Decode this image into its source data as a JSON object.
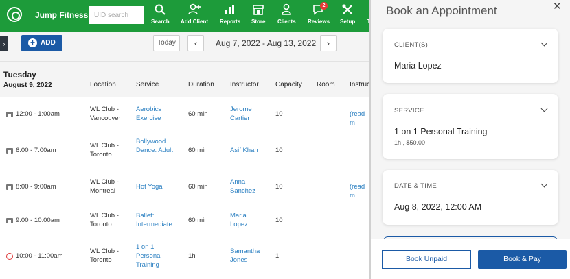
{
  "app": {
    "brand": "Jump Fitness",
    "uid_placeholder": "UID search"
  },
  "nav": [
    {
      "label": "Search",
      "icon": "search-icon"
    },
    {
      "label": "Add Client",
      "icon": "add-user-icon"
    },
    {
      "label": "Reports",
      "icon": "chart-icon"
    },
    {
      "label": "Store",
      "icon": "store-icon"
    },
    {
      "label": "Clients",
      "icon": "user-icon"
    },
    {
      "label": "Reviews",
      "icon": "chat-icon",
      "badge": "2"
    },
    {
      "label": "Setup",
      "icon": "tools-icon"
    },
    {
      "label": "T",
      "icon": "more-icon"
    }
  ],
  "toolbar": {
    "add_label": "ADD",
    "today_label": "Today",
    "prev_label": "‹",
    "next_label": "›",
    "date_range": "Aug 7, 2022 - Aug 13, 2022",
    "collapse_label": "›"
  },
  "schedule": {
    "day": "Tuesday",
    "date": "August 9, 2022",
    "columns": [
      "Location",
      "Service",
      "Duration",
      "Instructor",
      "Capacity",
      "Room",
      "Instruc"
    ],
    "rows": [
      {
        "time": "12:00 - 1:00am",
        "location": "WL Club - Vancouver",
        "service": "Aerobics Exercise",
        "duration": "60 min",
        "instructor": "Jerome Cartier",
        "capacity": "10",
        "note": "(read m"
      },
      {
        "time": "6:00 - 7:00am",
        "location": "WL Club - Toronto",
        "service": "Bollywood Dance: Adult",
        "duration": "60 min",
        "instructor": "Asif Khan",
        "capacity": "10",
        "note": ""
      },
      {
        "time": "8:00 - 9:00am",
        "location": "WL Club - Montreal",
        "service": "Hot Yoga",
        "duration": "60 min",
        "instructor": "Anna Sanchez",
        "capacity": "10",
        "note": "(read m"
      },
      {
        "time": "9:00 - 10:00am",
        "location": "WL Club - Toronto",
        "service": "Ballet: Intermediate",
        "duration": "60 min",
        "instructor": "Maria Lopez",
        "capacity": "10",
        "note": ""
      },
      {
        "time": "10:00 - 11:00am",
        "location": "WL Club - Toronto",
        "service": "1 on 1 Personal Training",
        "duration": "1h",
        "instructor": "Samantha Jones",
        "capacity": "1",
        "note": ""
      }
    ]
  },
  "panel": {
    "title": "Book an Appointment",
    "close": "✕",
    "client": {
      "label": "CLIENT(S)",
      "value": "Maria Lopez"
    },
    "service": {
      "label": "SERVICE",
      "value": "1 on 1 Personal Training",
      "sub": "1h , $50.00"
    },
    "datetime": {
      "label": "DATE & TIME",
      "value": "Aug 8, 2022, 12:00 AM"
    },
    "book_unpaid": "Book Unpaid",
    "book_pay": "Book & Pay"
  },
  "colors": {
    "brand_green": "#1d9b3a",
    "primary_blue": "#1b5aa6",
    "link_blue": "#2a7fc1"
  }
}
